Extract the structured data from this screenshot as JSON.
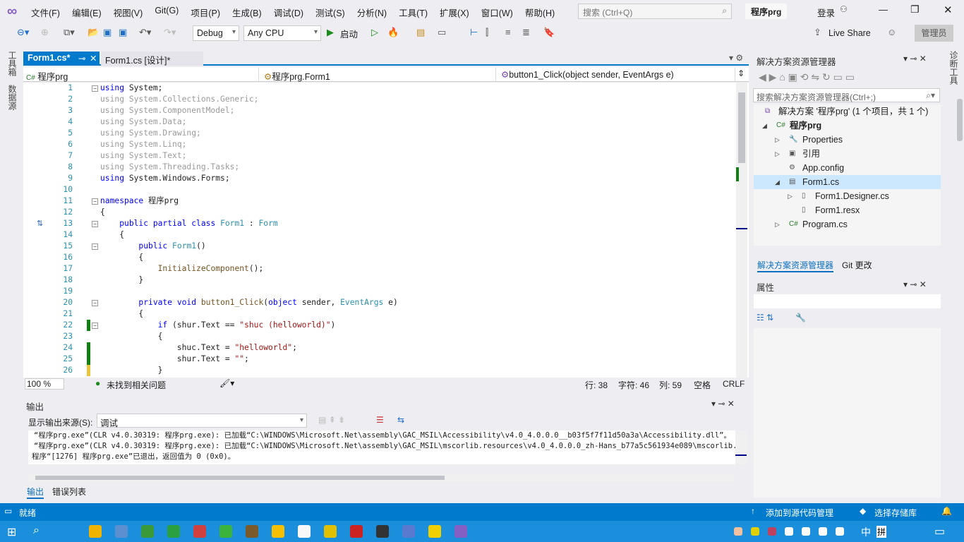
{
  "app": {
    "project_badge": "程序prg",
    "login": "登录",
    "admin": "管理员",
    "live_share": "Live Share"
  },
  "menu": [
    "文件(F)",
    "编辑(E)",
    "视图(V)",
    "Git(G)",
    "项目(P)",
    "生成(B)",
    "调试(D)",
    "测试(S)",
    "分析(N)",
    "工具(T)",
    "扩展(X)",
    "窗口(W)",
    "帮助(H)"
  ],
  "search": {
    "placeholder": "搜索 (Ctrl+Q)"
  },
  "toolbar": {
    "config": "Debug",
    "platform": "Any CPU",
    "start": "启动"
  },
  "left_strip": [
    "工具箱",
    "数据源"
  ],
  "right_strip": "诊断工具",
  "doc_tabs": [
    {
      "label": "Form1.cs*",
      "active": true
    },
    {
      "label": "Form1.cs [设计]*",
      "active": false
    }
  ],
  "nav": {
    "project": "程序prg",
    "class": "程序prg.Form1",
    "member": "button1_Click(object sender, EventArgs e)"
  },
  "code_lines": [
    [
      [
        "using",
        "k"
      ],
      [
        " System;",
        ""
      ]
    ],
    [
      [
        "using System.Collections.Generic;",
        "g"
      ]
    ],
    [
      [
        "using System.ComponentModel;",
        "g"
      ]
    ],
    [
      [
        "using System.Data;",
        "g"
      ]
    ],
    [
      [
        "using System.Drawing;",
        "g"
      ]
    ],
    [
      [
        "using System.Linq;",
        "g"
      ]
    ],
    [
      [
        "using System.Text;",
        "g"
      ]
    ],
    [
      [
        "using System.Threading.Tasks;",
        "g"
      ]
    ],
    [
      [
        "using",
        "k"
      ],
      [
        " System.Windows.Forms;",
        ""
      ]
    ],
    [],
    [
      [
        "namespace",
        "k"
      ],
      [
        " 程序prg",
        ""
      ]
    ],
    [
      [
        "{",
        ""
      ]
    ],
    [
      [
        "    ",
        ""
      ],
      [
        "public partial class",
        "k"
      ],
      [
        " ",
        ""
      ],
      [
        "Form1",
        "t"
      ],
      [
        " : ",
        ""
      ],
      [
        "Form",
        "t"
      ]
    ],
    [
      [
        "    {",
        ""
      ]
    ],
    [
      [
        "        ",
        ""
      ],
      [
        "public",
        "k"
      ],
      [
        " ",
        ""
      ],
      [
        "Form1",
        "t"
      ],
      [
        "()",
        ""
      ]
    ],
    [
      [
        "        {",
        ""
      ]
    ],
    [
      [
        "            ",
        ""
      ],
      [
        "InitializeComponent",
        "m"
      ],
      [
        "();",
        ""
      ]
    ],
    [
      [
        "        }",
        ""
      ]
    ],
    [],
    [
      [
        "        ",
        ""
      ],
      [
        "private void",
        "k"
      ],
      [
        " ",
        ""
      ],
      [
        "button1_Click",
        "m"
      ],
      [
        "(",
        ""
      ],
      [
        "object",
        "k"
      ],
      [
        " sender, ",
        ""
      ],
      [
        "EventArgs",
        "t"
      ],
      [
        " e)",
        ""
      ]
    ],
    [
      [
        "        {",
        ""
      ]
    ],
    [
      [
        "            ",
        ""
      ],
      [
        "if",
        "k"
      ],
      [
        " (shur.Text == ",
        ""
      ],
      [
        "\"shuc (helloworld)\"",
        "s"
      ],
      [
        ")",
        ""
      ]
    ],
    [
      [
        "            {",
        ""
      ]
    ],
    [
      [
        "                shuc.Text = ",
        ""
      ],
      [
        "\"helloworld\"",
        "s"
      ],
      [
        ";",
        ""
      ]
    ],
    [
      [
        "                shur.Text = ",
        ""
      ],
      [
        "\"\"",
        "s"
      ],
      [
        ";",
        ""
      ]
    ],
    [
      [
        "            }",
        ""
      ]
    ]
  ],
  "editor_status": {
    "zoom": "100 %",
    "issues": "未找到相关问题",
    "line": "行: 38",
    "char": "字符: 46",
    "col": "列: 59",
    "ws": "空格",
    "eol": "CRLF"
  },
  "output": {
    "title": "输出",
    "source_label": "显示输出来源(S):",
    "source_value": "调试",
    "lines": [
      "“程序prg.exe”(CLR v4.0.30319: 程序prg.exe): 已加载“C:\\WINDOWS\\Microsoft.Net\\assembly\\GAC_MSIL\\Accessibility\\v4.0_4.0.0.0__b03f5f7f11d50a3a\\Accessibility.dll”。",
      "“程序prg.exe”(CLR v4.0.30319: 程序prg.exe): 已加载“C:\\WINDOWS\\Microsoft.Net\\assembly\\GAC_MSIL\\mscorlib.resources\\v4.0_4.0.0.0_zh-Hans_b77a5c561934e089\\mscorlib.res",
      "程序“[1276] 程序prg.exe”已退出，返回值为 0 (0x0)。"
    ],
    "tabs": [
      "输出",
      "错误列表"
    ]
  },
  "solution_explorer": {
    "title": "解决方案资源管理器",
    "search_placeholder": "搜索解决方案资源管理器(Ctrl+;)",
    "nodes": [
      {
        "label": "解决方案 '程序prg' (1 个项目，共 1 个)",
        "icon": "solution-icon"
      },
      {
        "label": "程序prg",
        "icon": "csharp-project-icon"
      },
      {
        "label": "Properties",
        "icon": "wrench-icon"
      },
      {
        "label": "引用",
        "icon": "references-icon"
      },
      {
        "label": "App.config",
        "icon": "config-icon"
      },
      {
        "label": "Form1.cs",
        "icon": "form-icon"
      },
      {
        "label": "Form1.Designer.cs",
        "icon": "file-icon"
      },
      {
        "label": "Form1.resx",
        "icon": "file-icon"
      },
      {
        "label": "Program.cs",
        "icon": "csharp-file-icon"
      }
    ],
    "tabs": [
      "解决方案资源管理器",
      "Git 更改"
    ]
  },
  "properties": {
    "title": "属性"
  },
  "statusbar": {
    "ready": "就绪",
    "source_control": "添加到源代码管理",
    "repo": "选择存储库"
  },
  "taskbar": {
    "ime_lang": "中",
    "ime_mode": "拼"
  },
  "colors": {
    "accent": "#007acc",
    "keyword": "#0000ff",
    "type": "#2b91af",
    "string": "#a31515"
  }
}
